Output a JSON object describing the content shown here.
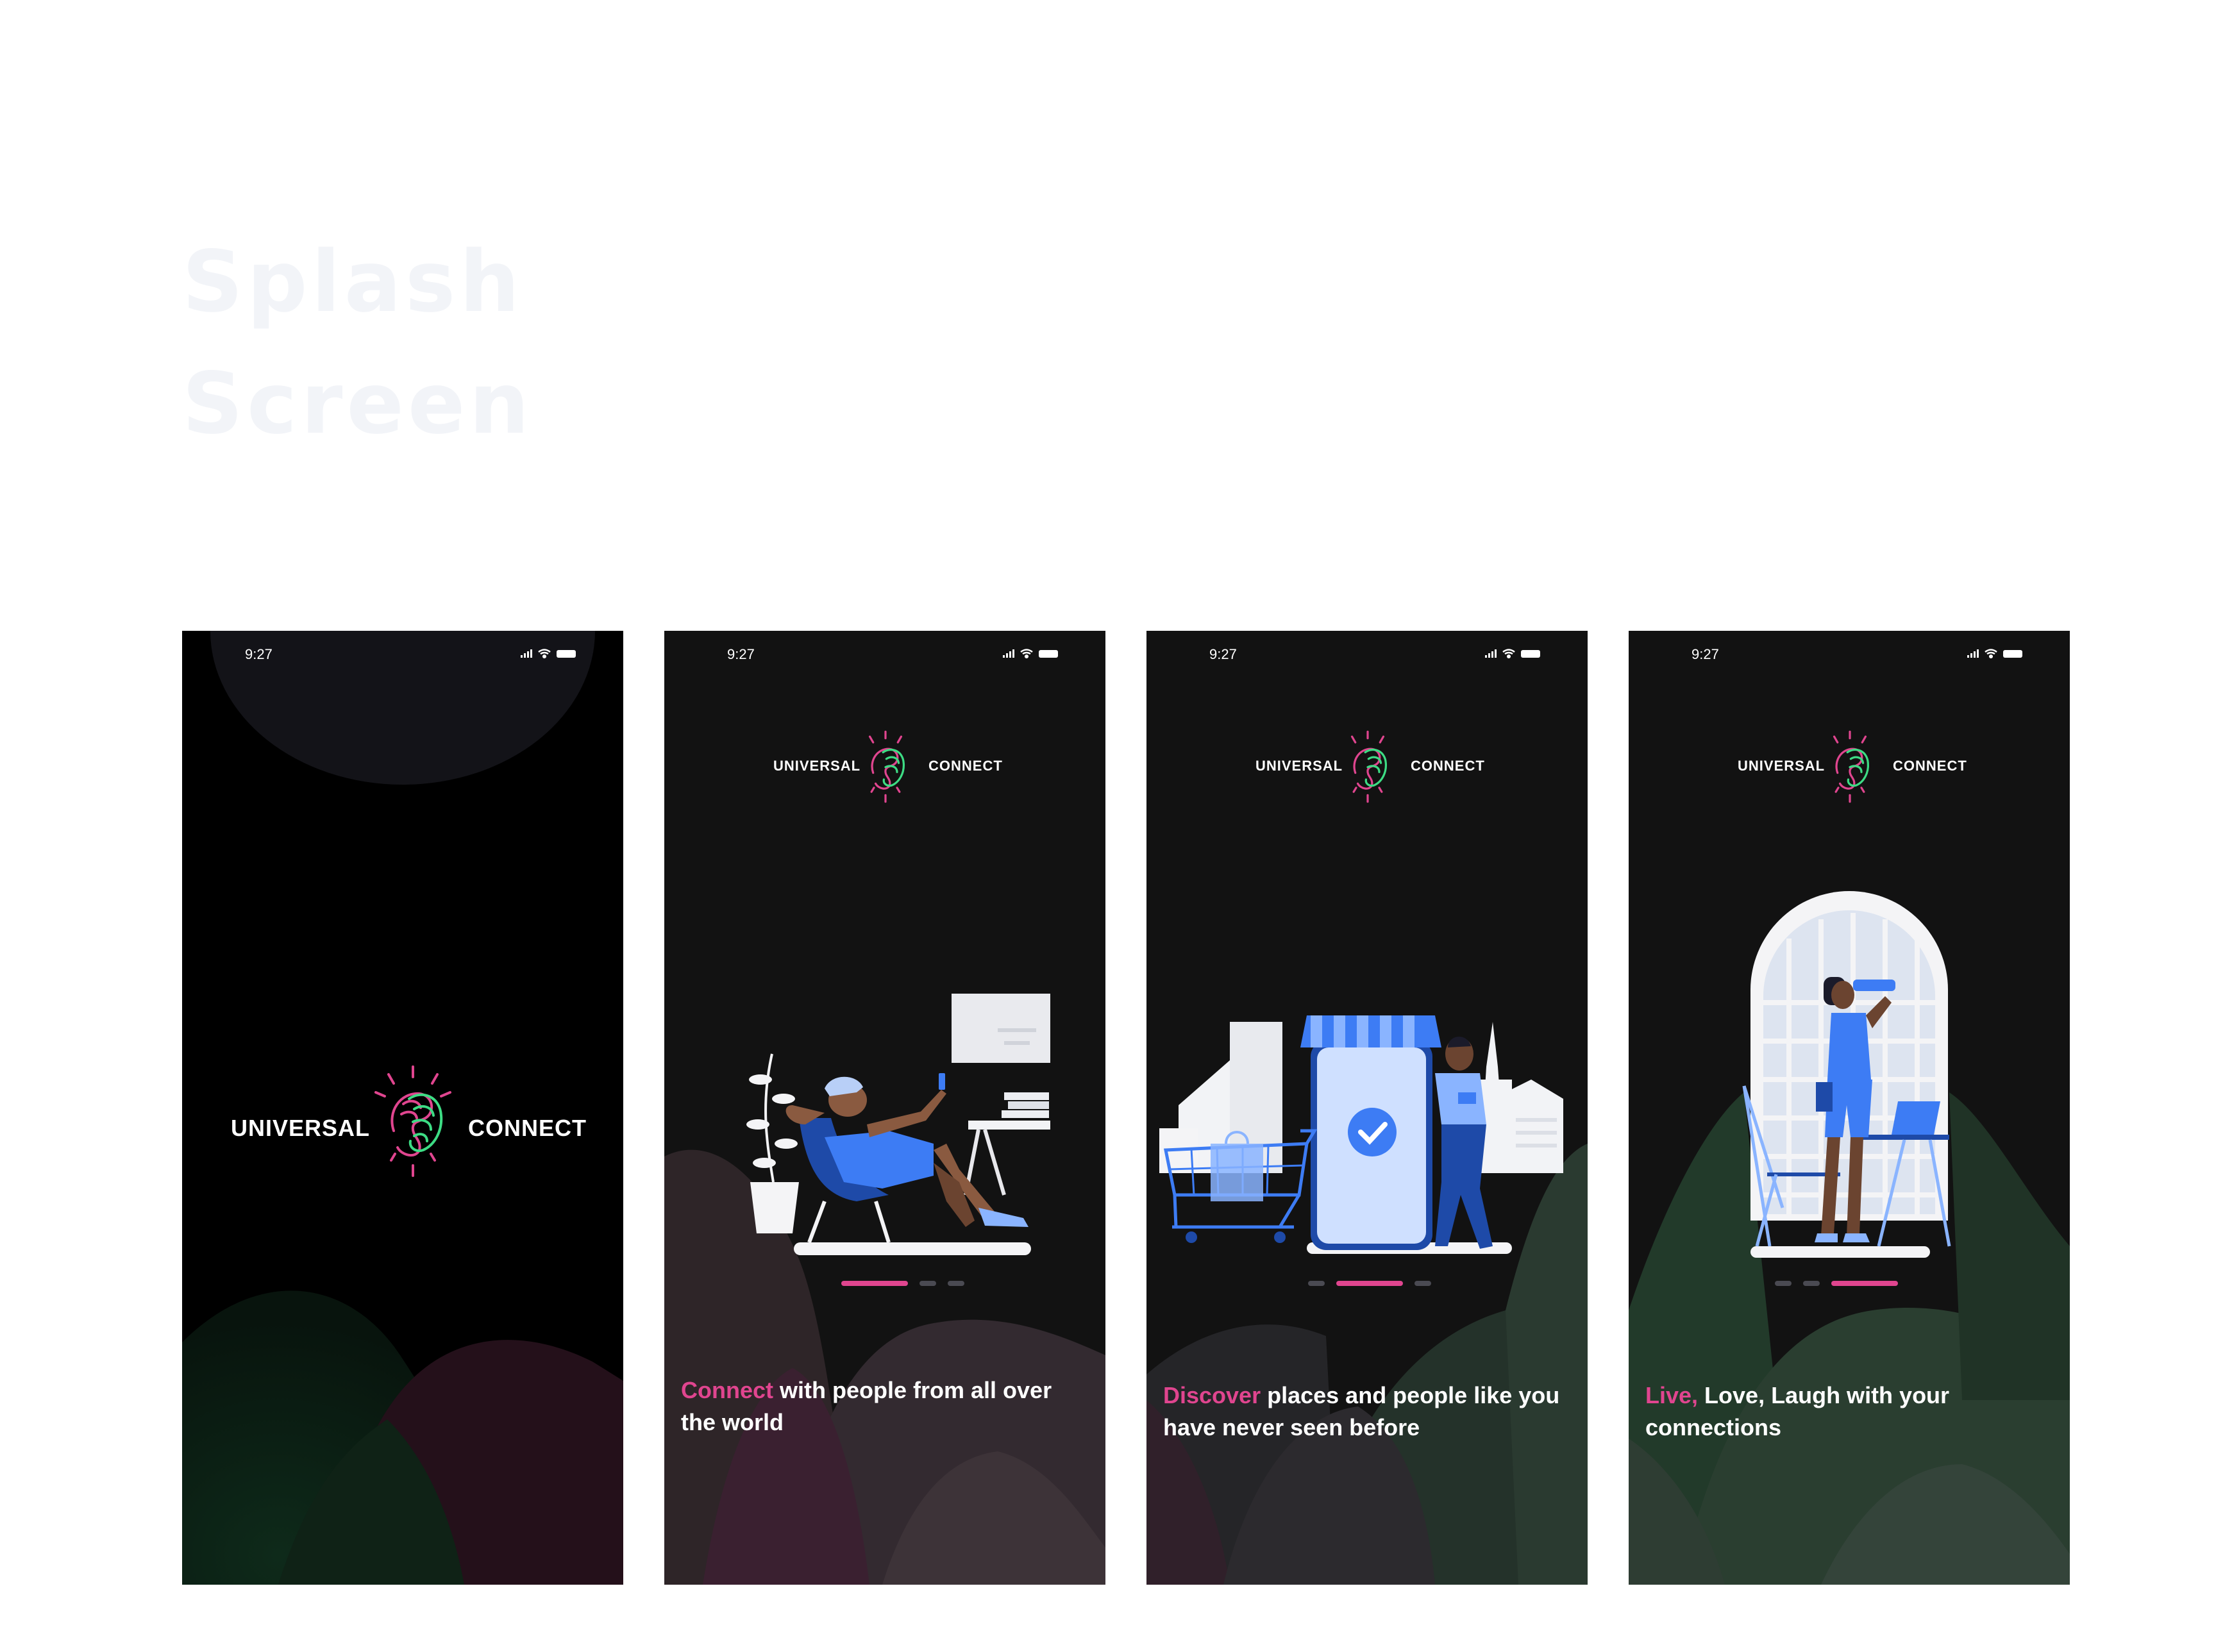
{
  "page": {
    "title_line1": "Splash",
    "title_line2": "Screen"
  },
  "status_bar": {
    "time": "9:27"
  },
  "brand": {
    "left_word": "UNIVERSAL",
    "right_word": "CONNECT"
  },
  "onboarding": [
    {
      "highlight": "Connect",
      "rest": " with people from all over the world",
      "active_step": 1
    },
    {
      "highlight": "Discover",
      "rest": " places and people like you have never seen before",
      "active_step": 2
    },
    {
      "highlight": "Live,",
      "rest": " Love, Laugh with your connections",
      "active_step": 3
    }
  ],
  "colors": {
    "accent_pink": "#e0458f",
    "accent_green": "#3ddc84",
    "illustration_blue": "#3d7cf4",
    "screen_bg": "#121212"
  },
  "icons": [
    "signal-icon",
    "wifi-icon",
    "battery-icon",
    "brain-logo-icon"
  ]
}
